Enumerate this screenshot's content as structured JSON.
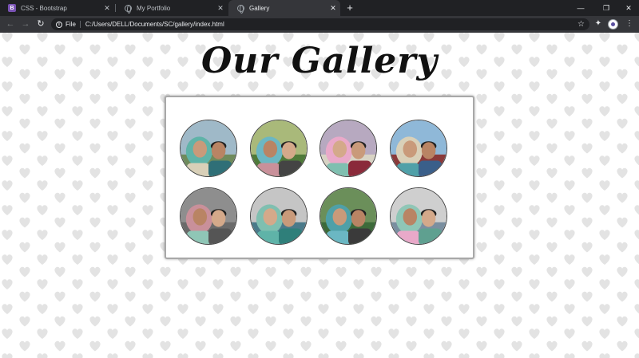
{
  "browser": {
    "tabs": [
      {
        "title": "CSS - Bootstrap",
        "favicon": "bootstrap-icon",
        "active": false
      },
      {
        "title": "My Portfolio",
        "favicon": "globe-icon",
        "active": false
      },
      {
        "title": "Gallery",
        "favicon": "globe-icon",
        "active": true
      }
    ],
    "address_scheme": "File",
    "address_url": "C:/Users/DELL/Documents/SC/gallery/index.html"
  },
  "page": {
    "heading": "Our Gallery",
    "background_pattern": "heart-pattern",
    "pattern_color": "#e3e3e3"
  },
  "gallery": {
    "photo_count": 8,
    "items": [
      {
        "name": "photo-1",
        "sky": "#9fb9c8",
        "ground": "#6f8b5c"
      },
      {
        "name": "photo-2",
        "sky": "#a9b97a",
        "ground": "#4f7a3a"
      },
      {
        "name": "photo-3",
        "sky": "#b7a9c0",
        "ground": "#d8d3c4"
      },
      {
        "name": "photo-4",
        "sky": "#8fb8d8",
        "ground": "#8a3a3a"
      },
      {
        "name": "photo-5",
        "sky": "#8e8e8e",
        "ground": "#6a6a6a"
      },
      {
        "name": "photo-6",
        "sky": "#c5c5c5",
        "ground": "#4a7a8a"
      },
      {
        "name": "photo-7",
        "sky": "#6b8f5a",
        "ground": "#3d6a3a"
      },
      {
        "name": "photo-8",
        "sky": "#cfcfcf",
        "ground": "#7a8fa0"
      }
    ]
  }
}
